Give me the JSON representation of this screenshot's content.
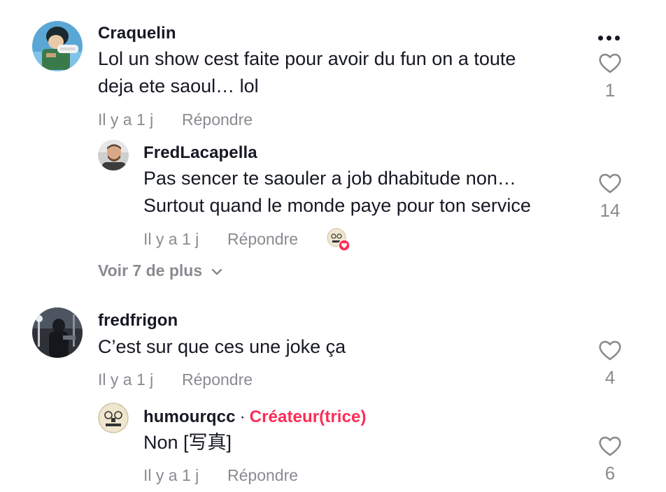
{
  "comments": [
    {
      "username": "Craquelin",
      "text_lines": [
        "Lol un show cest faite pour avoir du fun on a toute",
        "deja ete saoul… lol"
      ],
      "time": "Il y a 1 j",
      "reply_label": "Répondre",
      "likes": "1",
      "avatar_icon": "cartoon-avatar-icon",
      "replies": [
        {
          "username": "FredLacapella",
          "text_lines": [
            "Pas sencer te saouler a job dhabitude non…",
            "Surtout quand le monde paye pour ton service"
          ],
          "time": "Il y a 1 j",
          "reply_label": "Répondre",
          "likes": "14",
          "creator_liked": true
        }
      ],
      "view_more": "Voir 7 de plus"
    },
    {
      "username": "fredfrigon",
      "text_lines": [
        "C’est sur que ces une joke ça"
      ],
      "time": "Il y a 1 j",
      "reply_label": "Répondre",
      "likes": "4",
      "replies": [
        {
          "username": "humourqcc",
          "separator": "·",
          "creator_badge": "Créateur(trice)",
          "text_lines": [
            "Non [写真]"
          ],
          "time": "Il y a 1 j",
          "reply_label": "Répondre",
          "likes": "6"
        }
      ]
    }
  ],
  "colors": {
    "accent": "#fe2c55",
    "muted": "#8a8b91",
    "text": "#161823"
  }
}
